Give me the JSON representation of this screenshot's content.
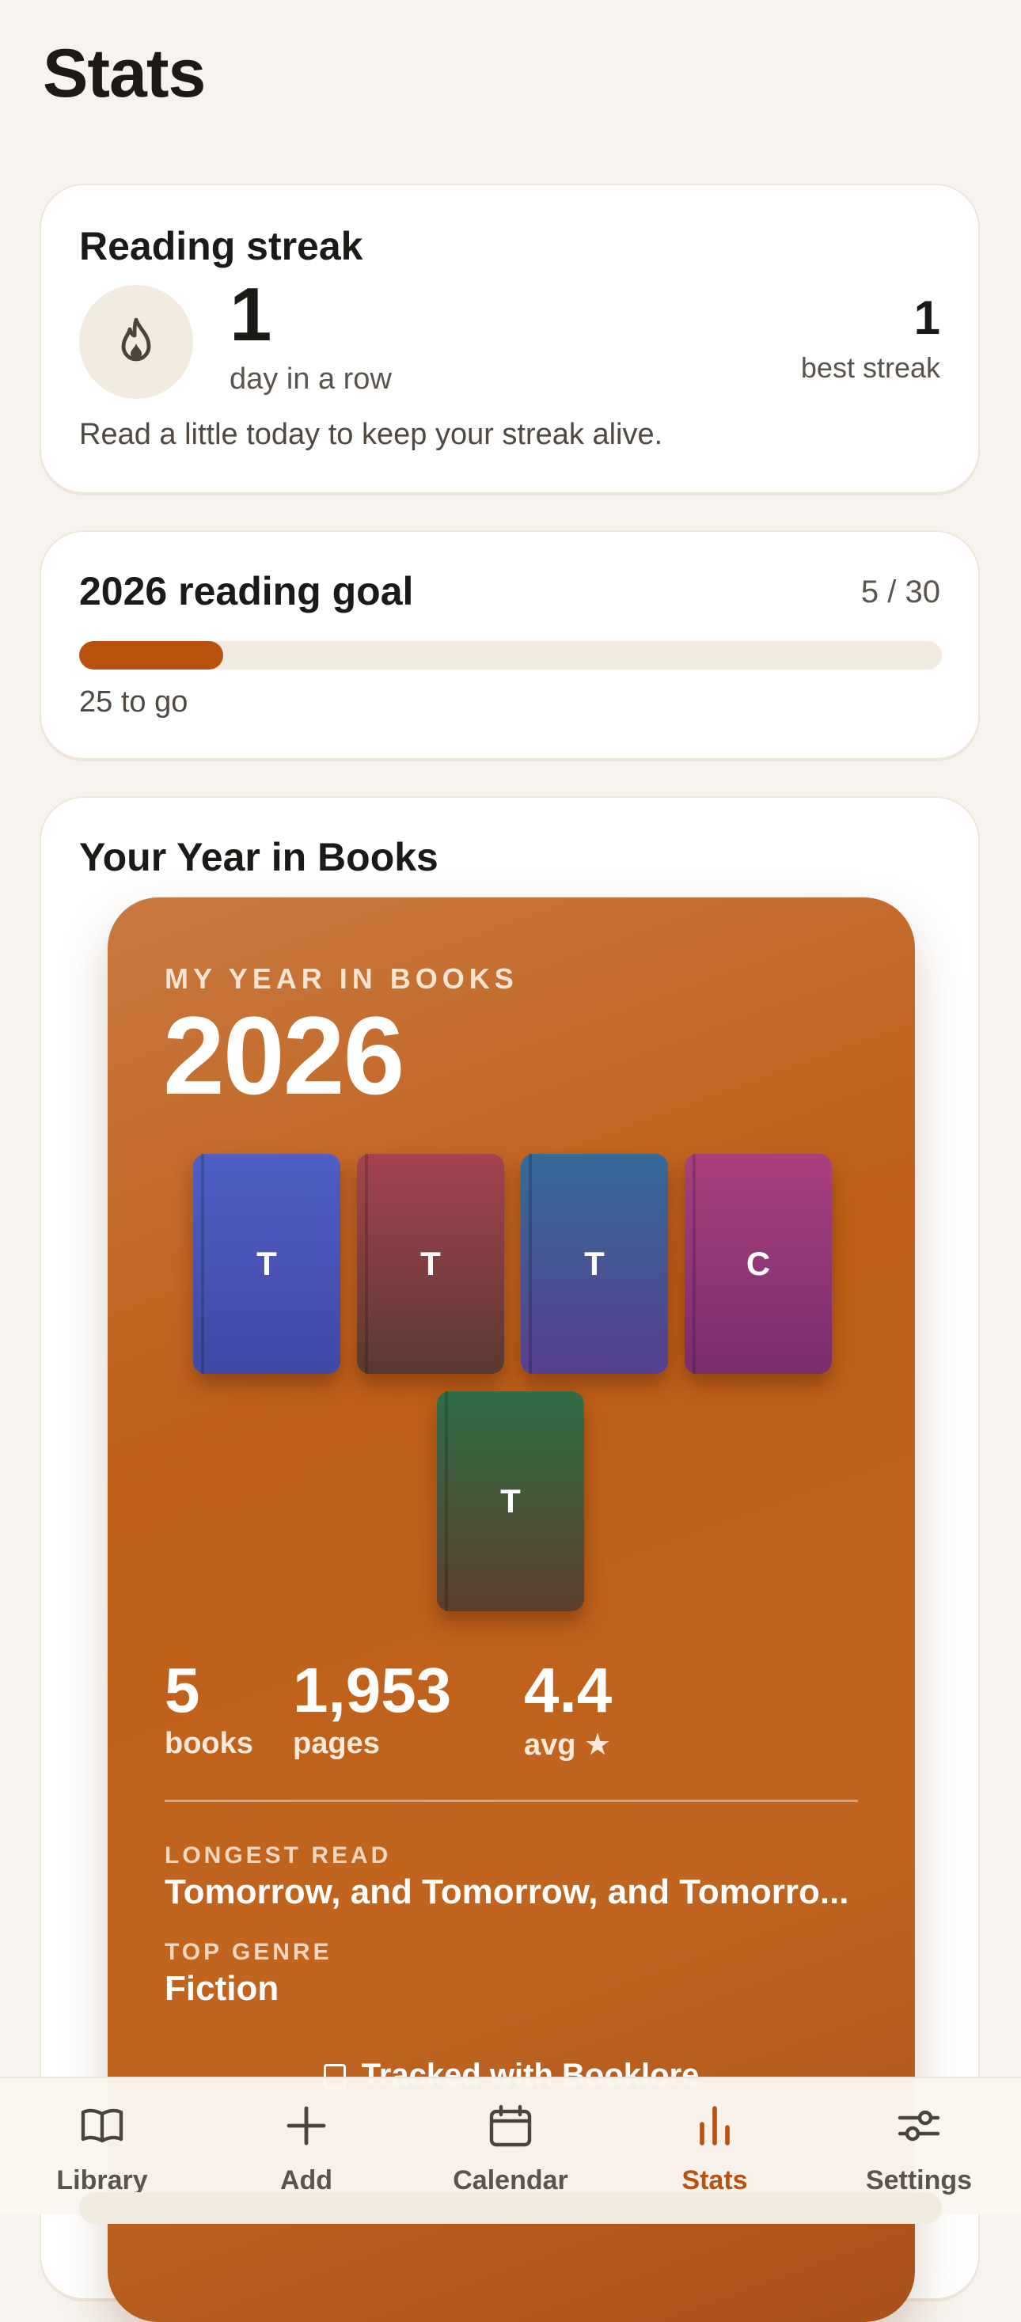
{
  "page": {
    "title": "Stats"
  },
  "streak": {
    "title": "Reading streak",
    "icon": "flame-icon",
    "count": "1",
    "count_label": "day in a row",
    "best": "1",
    "best_label": "best streak",
    "message": "Read a little today to keep your streak alive."
  },
  "goal": {
    "title": "2026 reading goal",
    "count": "5 / 30",
    "progress": 0.167,
    "remaining": "25 to go",
    "accent": "#b9510f"
  },
  "year_card": {
    "title": "Your Year in Books",
    "kicker": "MY YEAR IN BOOKS",
    "year": "2026",
    "books": [
      {
        "letter": "T",
        "color_top": "#4f5fc4",
        "color_bottom": "#4148a6"
      },
      {
        "letter": "T",
        "color_top": "#a54350",
        "color_bottom": "#5a3a30"
      },
      {
        "letter": "T",
        "color_top": "#356a99",
        "color_bottom": "#573f8f"
      },
      {
        "letter": "C",
        "color_top": "#a9407d",
        "color_bottom": "#7a2d6e"
      },
      {
        "letter": "T",
        "color_top": "#2f6e45",
        "color_bottom": "#5d3e2e"
      }
    ],
    "stats": [
      {
        "value": "5",
        "label": "books"
      },
      {
        "value": "1,953",
        "label": "pages"
      },
      {
        "value": "4.4",
        "label": "avg ★"
      }
    ],
    "longest_label": "LONGEST READ",
    "longest_value": "Tomorrow, and Tomorrow, and Tomorro...",
    "genre_label": "TOP GENRE",
    "genre_value": "Fiction",
    "tracked": "Tracked with Booklore"
  },
  "tabs": [
    {
      "label": "Library",
      "icon": "book-icon",
      "active": false
    },
    {
      "label": "Add",
      "icon": "plus-icon",
      "active": false
    },
    {
      "label": "Calendar",
      "icon": "calendar-icon",
      "active": false
    },
    {
      "label": "Stats",
      "icon": "bar-chart-icon",
      "active": true
    },
    {
      "label": "Settings",
      "icon": "sliders-icon",
      "active": false
    }
  ]
}
